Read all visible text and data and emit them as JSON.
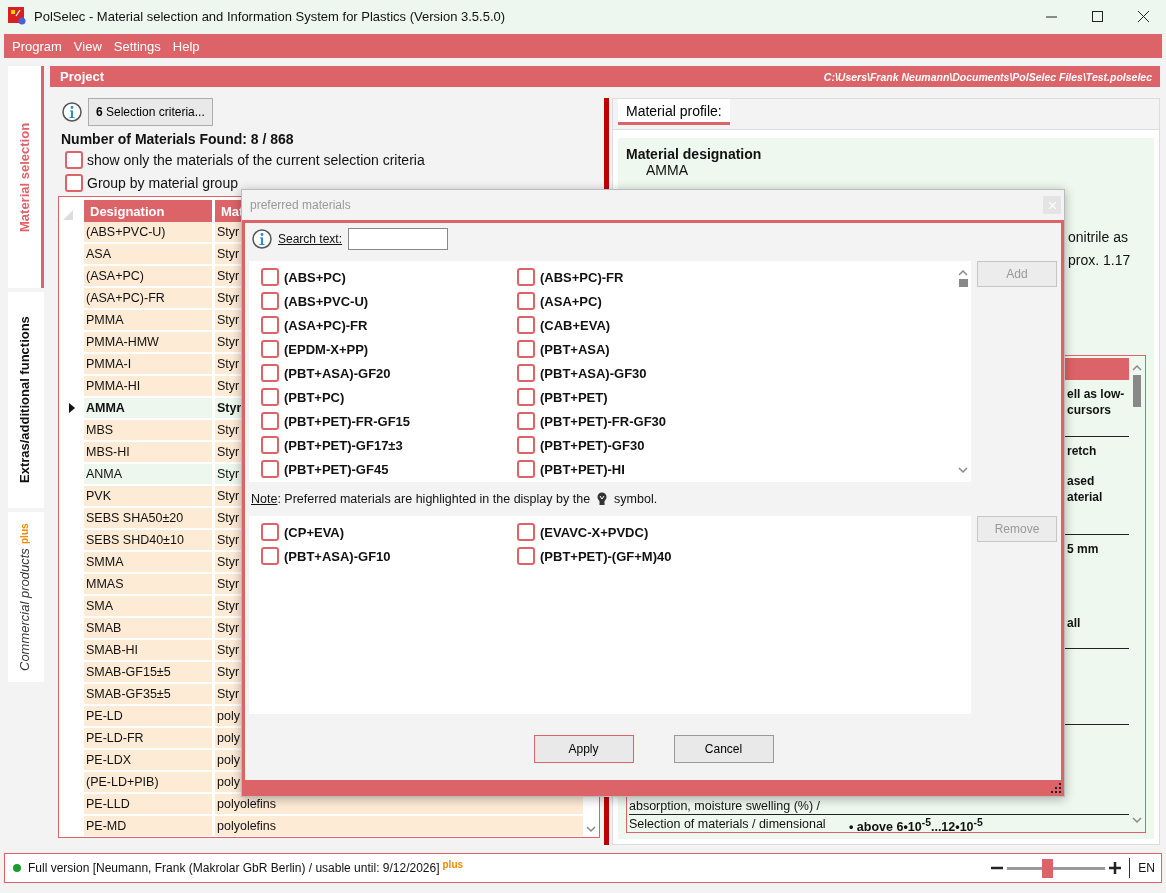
{
  "window": {
    "title": "PolSelec - Material selection and Information System for Plastics (Version 3.5.5.0)"
  },
  "menu": [
    "Program",
    "View",
    "Settings",
    "Help"
  ],
  "side_tabs": [
    {
      "label": "Material selection",
      "selected": true
    },
    {
      "label": "Extras/additional functions",
      "selected": false
    },
    {
      "label": "Commercial products",
      "badge": "plus",
      "selected": false
    }
  ],
  "project": {
    "title": "Project",
    "path": "C:\\Users\\Frank Neumann\\Documents\\PolSelec Files\\Test.polselec"
  },
  "selection": {
    "button": "**6** Selection criteria...",
    "found": "Number of Materials Found: 8 / 868",
    "options": [
      {
        "label": "show only the materials of the current selection criteria",
        "checked": false
      },
      {
        "label": "Group by material group",
        "checked": false
      }
    ]
  },
  "materials_table": {
    "columns": [
      "Designation",
      "Mat"
    ],
    "rows": [
      {
        "designation": "(ABS+PVC-U)",
        "material": "Styr",
        "selected": false,
        "highlighted": false
      },
      {
        "designation": "ASA",
        "material": "Styr",
        "selected": false,
        "highlighted": false
      },
      {
        "designation": "(ASA+PC)",
        "material": "Styr",
        "selected": false,
        "highlighted": false
      },
      {
        "designation": "(ASA+PC)-FR",
        "material": "Styr",
        "selected": false,
        "highlighted": false
      },
      {
        "designation": "PMMA",
        "material": "Styr",
        "selected": false,
        "highlighted": false
      },
      {
        "designation": "PMMA-HMW",
        "material": "Styr",
        "selected": false,
        "highlighted": false
      },
      {
        "designation": "PMMA-I",
        "material": "Styr",
        "selected": false,
        "highlighted": false
      },
      {
        "designation": "PMMA-HI",
        "material": "Styr",
        "selected": false,
        "highlighted": false
      },
      {
        "designation": "AMMA",
        "material": "Styr",
        "selected": true,
        "highlighted": true
      },
      {
        "designation": "MBS",
        "material": "Styr",
        "selected": false,
        "highlighted": false
      },
      {
        "designation": "MBS-HI",
        "material": "Styr",
        "selected": false,
        "highlighted": false
      },
      {
        "designation": "ANMA",
        "material": "Styr",
        "selected": false,
        "highlighted": true
      },
      {
        "designation": "PVK",
        "material": "Styr",
        "selected": false,
        "highlighted": false
      },
      {
        "designation": "SEBS SHA50±20",
        "material": "Styr",
        "selected": false,
        "highlighted": false
      },
      {
        "designation": "SEBS SHD40±10",
        "material": "Styr",
        "selected": false,
        "highlighted": false
      },
      {
        "designation": "SMMA",
        "material": "Styr",
        "selected": false,
        "highlighted": false
      },
      {
        "designation": "MMAS",
        "material": "Styr",
        "selected": false,
        "highlighted": false
      },
      {
        "designation": "SMA",
        "material": "Styr",
        "selected": false,
        "highlighted": false
      },
      {
        "designation": "SMAB",
        "material": "Styr",
        "selected": false,
        "highlighted": false
      },
      {
        "designation": "SMAB-HI",
        "material": "Styr",
        "selected": false,
        "highlighted": false
      },
      {
        "designation": "SMAB-GF15±5",
        "material": "Styr",
        "selected": false,
        "highlighted": false
      },
      {
        "designation": "SMAB-GF35±5",
        "material": "Styr",
        "selected": false,
        "highlighted": false
      },
      {
        "designation": "PE-LD",
        "material": "poly",
        "selected": false,
        "highlighted": false
      },
      {
        "designation": "PE-LD-FR",
        "material": "poly",
        "selected": false,
        "highlighted": false
      },
      {
        "designation": "PE-LDX",
        "material": "poly",
        "selected": false,
        "highlighted": false
      },
      {
        "designation": "(PE-LD+PIB)",
        "material": "poly",
        "selected": false,
        "highlighted": false
      },
      {
        "designation": "PE-LLD",
        "material": "polyolefins",
        "selected": false,
        "highlighted": false
      },
      {
        "designation": "PE-MD",
        "material": "polyolefins",
        "selected": false,
        "highlighted": false
      }
    ]
  },
  "profile": {
    "tabs": [
      {
        "label": "Material profile:",
        "selected": true
      }
    ],
    "designation_label": "Material designation",
    "designation": "AMMA",
    "description": [
      "onitrile as",
      "prox. 1.17"
    ],
    "properties": [
      {
        "kind": "fragment",
        "blocks": [
          [
            "ell as low-",
            "cursors"
          ]
        ]
      },
      {
        "kind": "fragment",
        "blocks": [
          [
            "retch"
          ],
          [
            "ased",
            "aterial"
          ]
        ]
      },
      {
        "kind": "fragment",
        "blocks": [
          [
            "5 mm"
          ],
          [
            "all"
          ]
        ]
      },
      {
        "kind": "empty"
      },
      {
        "kind": "label",
        "label": "absorption, moisture swelling (%) /"
      },
      {
        "kind": "label",
        "label": "Selection of materials / dimensional",
        "value": "• above 6•10$^{-5}$...12•10$^{-5}$"
      }
    ]
  },
  "dialog": {
    "title": "preferred materials",
    "search_label": "Search text:",
    "available": [
      {
        "label": "(ABS+PC)",
        "checked": false
      },
      {
        "label": "(ABS+PC)-FR",
        "checked": false
      },
      {
        "label": "(ABS+PVC-U)",
        "checked": false
      },
      {
        "label": "(ASA+PC)",
        "checked": false
      },
      {
        "label": "(ASA+PC)-FR",
        "checked": false
      },
      {
        "label": "(CAB+EVA)",
        "checked": false
      },
      {
        "label": "(EPDM-X+PP)",
        "checked": false
      },
      {
        "label": "(PBT+ASA)",
        "checked": false
      },
      {
        "label": "(PBT+ASA)-GF20",
        "checked": false
      },
      {
        "label": "(PBT+ASA)-GF30",
        "checked": false
      },
      {
        "label": "(PBT+PC)",
        "checked": false
      },
      {
        "label": "(PBT+PET)",
        "checked": false
      },
      {
        "label": "(PBT+PET)-FR-GF15",
        "checked": false
      },
      {
        "label": "(PBT+PET)-FR-GF30",
        "checked": false
      },
      {
        "label": "(PBT+PET)-GF17±3",
        "checked": false
      },
      {
        "label": "(PBT+PET)-GF30",
        "checked": false
      },
      {
        "label": "(PBT+PET)-GF45",
        "checked": false
      },
      {
        "label": "(PBT+PET)-HI",
        "checked": false
      }
    ],
    "add_button": {
      "label": "Add",
      "disabled": true
    },
    "note_label": "Note",
    "note_text": ": Preferred materials are highlighted in the display by the",
    "note_end": "symbol.",
    "preferred": [
      {
        "label": "(CP+EVA)",
        "checked": false
      },
      {
        "label": "(EVAVC-X+PVDC)",
        "checked": false
      },
      {
        "label": "(PBT+ASA)-GF10",
        "checked": false
      },
      {
        "label": "(PBT+PET)-(GF+M)40",
        "checked": false
      }
    ],
    "remove_button": {
      "label": "Remove",
      "disabled": true
    },
    "buttons": [
      {
        "label": "Apply",
        "default": true
      },
      {
        "label": "Cancel",
        "default": false
      }
    ]
  },
  "status_bar": {
    "text": "Full version [Neumann, Frank (Makrolar GbR Berlin) / usable until: 9/12/2026]",
    "badge": "plus",
    "zoom": {
      "level": 0.4
    },
    "language": "EN"
  }
}
